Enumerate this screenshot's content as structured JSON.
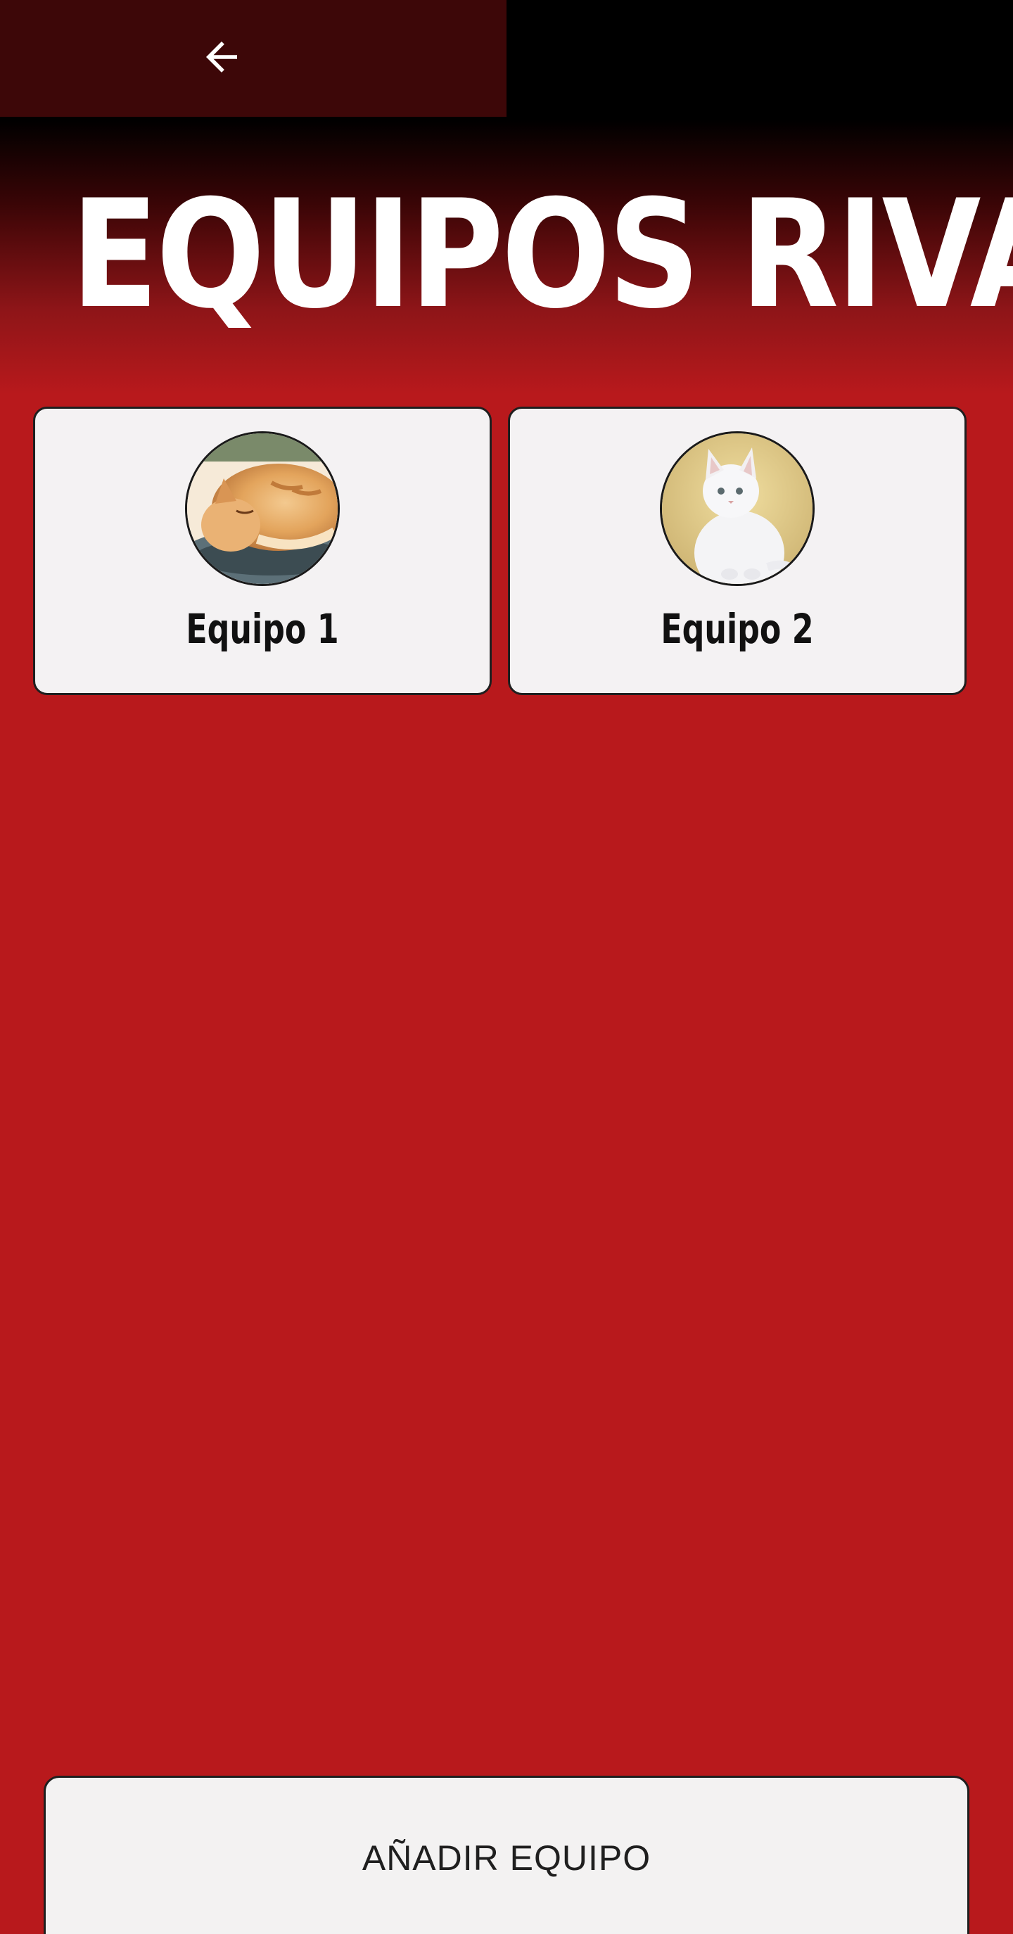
{
  "header": {
    "back_icon": "arrow-left-icon",
    "title": "EQUIPOS RIVALES"
  },
  "teams": [
    {
      "name": "Equipo 1",
      "avatar": "orange-cat-sleeping"
    },
    {
      "name": "Equipo 2",
      "avatar": "white-kitten-sitting"
    }
  ],
  "actions": {
    "add_team_label": "AÑADIR EQUIPO"
  },
  "colors": {
    "background_red": "#b8191c",
    "topbar": "#3d0708",
    "card": "#f4f2f3"
  }
}
